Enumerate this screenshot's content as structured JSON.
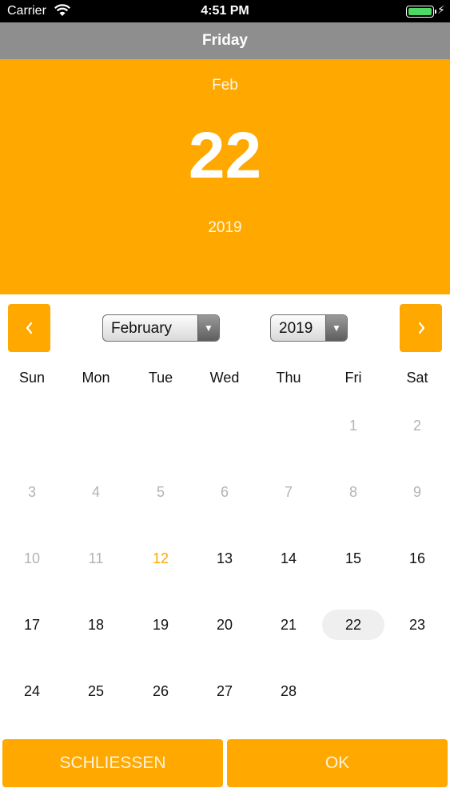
{
  "status_bar": {
    "carrier": "Carrier",
    "time": "4:51 PM",
    "battery_level": 1.0,
    "battery_color": "#4cd964"
  },
  "nav_bar": {
    "title": "Friday"
  },
  "header": {
    "month_short": "Feb",
    "day": "22",
    "year": "2019",
    "accent_color": "#ffa800"
  },
  "month_nav": {
    "prev_icon": "chevron-left-icon",
    "next_icon": "chevron-right-icon",
    "month_value": "February",
    "year_value": "2019"
  },
  "weekdays": [
    "Sun",
    "Mon",
    "Tue",
    "Wed",
    "Thu",
    "Fri",
    "Sat"
  ],
  "weeks": [
    [
      null,
      null,
      null,
      null,
      null,
      {
        "label": "1",
        "state": "disabled"
      },
      {
        "label": "2",
        "state": "disabled"
      }
    ],
    [
      {
        "label": "3",
        "state": "disabled"
      },
      {
        "label": "4",
        "state": "disabled"
      },
      {
        "label": "5",
        "state": "disabled"
      },
      {
        "label": "6",
        "state": "disabled"
      },
      {
        "label": "7",
        "state": "disabled"
      },
      {
        "label": "8",
        "state": "disabled"
      },
      {
        "label": "9",
        "state": "disabled"
      }
    ],
    [
      {
        "label": "10",
        "state": "disabled"
      },
      {
        "label": "11",
        "state": "disabled"
      },
      {
        "label": "12",
        "state": "today"
      },
      {
        "label": "13",
        "state": "normal"
      },
      {
        "label": "14",
        "state": "normal"
      },
      {
        "label": "15",
        "state": "normal"
      },
      {
        "label": "16",
        "state": "normal"
      }
    ],
    [
      {
        "label": "17",
        "state": "normal"
      },
      {
        "label": "18",
        "state": "normal"
      },
      {
        "label": "19",
        "state": "normal"
      },
      {
        "label": "20",
        "state": "normal"
      },
      {
        "label": "21",
        "state": "normal"
      },
      {
        "label": "22",
        "state": "selected"
      },
      {
        "label": "23",
        "state": "normal"
      }
    ],
    [
      {
        "label": "24",
        "state": "normal"
      },
      {
        "label": "25",
        "state": "normal"
      },
      {
        "label": "26",
        "state": "normal"
      },
      {
        "label": "27",
        "state": "normal"
      },
      {
        "label": "28",
        "state": "normal"
      },
      null,
      null
    ]
  ],
  "footer": {
    "close_label": "SCHLIESSEN",
    "ok_label": "OK"
  }
}
